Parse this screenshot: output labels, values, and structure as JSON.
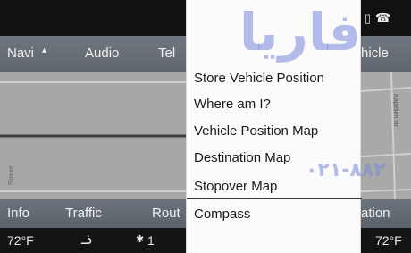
{
  "header": {
    "tabs_left": [
      "Navi",
      "Audio",
      "Tel"
    ],
    "tab_right_partial": "hicle"
  },
  "map": {
    "left_street_label": "Street",
    "right_street_label": "Kapellen str"
  },
  "menu": {
    "items": [
      "Store Vehicle Position",
      "Where am I?",
      "Vehicle Position Map",
      "Destination Map",
      "Stopover Map",
      "Compass"
    ]
  },
  "bottom_tabs": {
    "left": [
      "Info",
      "Traffic",
      "Rout"
    ],
    "right_partial": "ation"
  },
  "status": {
    "temp_left": "72°F",
    "temp_right": "72°F",
    "connection_count": "1"
  },
  "watermark": {
    "text_top": "فاریا",
    "text_bottom": "۰۲۱-۸۸۲"
  },
  "colors": {
    "menu_bg": "#fbfbfb",
    "tab_bar": "#6b737c",
    "map_bg": "#a7a7a7",
    "watermark": "#7887dc"
  }
}
